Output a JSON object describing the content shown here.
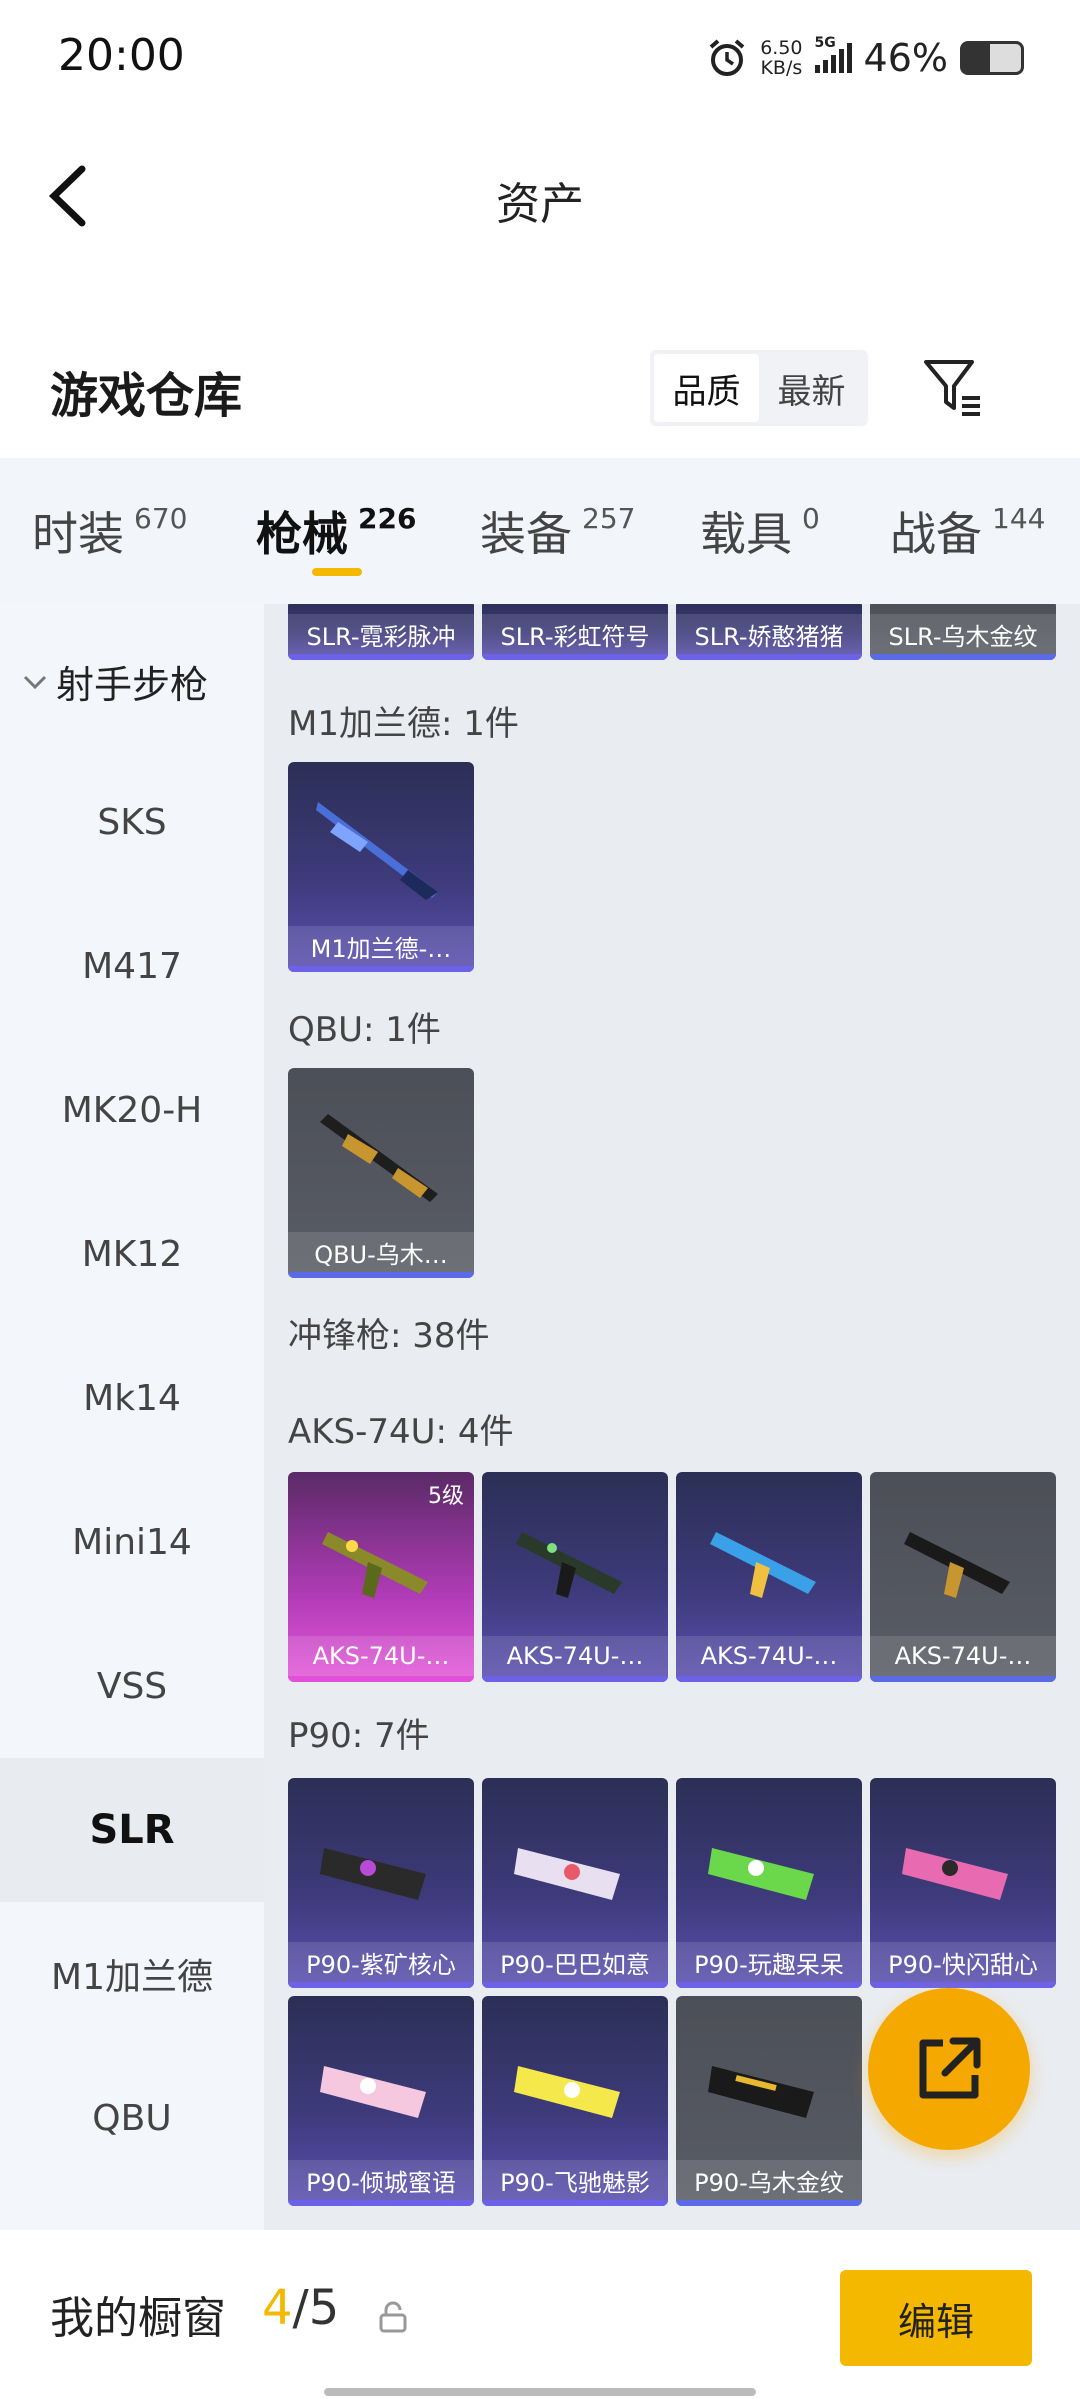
{
  "status_bar": {
    "time": "20:00",
    "net_speed_value": "6.50",
    "net_speed_unit": "KB/s",
    "network": "5G",
    "battery_percent": "46%",
    "battery_level": 0.46,
    "icons": [
      "alarm-icon",
      "signal-icon",
      "battery-icon"
    ]
  },
  "nav": {
    "title": "资产",
    "back_icon": "chevron-left-icon"
  },
  "warehouse": {
    "title": "游戏仓库",
    "sort_options": [
      "品质",
      "最新"
    ],
    "selected_sort": "品质",
    "filter_icon": "filter-icon"
  },
  "tabs": [
    {
      "label": "时装",
      "count": "670"
    },
    {
      "label": "枪械",
      "count": "226",
      "active": true
    },
    {
      "label": "装备",
      "count": "257"
    },
    {
      "label": "载具",
      "count": "0"
    },
    {
      "label": "战备",
      "count": "144"
    }
  ],
  "sidebar": {
    "group": "射手步枪",
    "items": [
      "SKS",
      "M417",
      "MK20-H",
      "MK12",
      "Mk14",
      "Mini14",
      "VSS",
      "SLR",
      "M1加兰德",
      "QBU"
    ],
    "selected": "SLR"
  },
  "content": {
    "top_cards": [
      {
        "name": "SLR-霓彩脉冲",
        "quality": "purple"
      },
      {
        "name": "SLR-彩虹符号",
        "quality": "purple"
      },
      {
        "name": "SLR-娇憨猪猪",
        "quality": "purple"
      },
      {
        "name": "SLR-乌木金纹",
        "quality": "grey"
      }
    ],
    "m1_label": "M1加兰德: 1件",
    "m1_cards": [
      {
        "name": "M1加兰德-…",
        "quality": "purple"
      }
    ],
    "qbu_label": "QBU: 1件",
    "qbu_cards": [
      {
        "name": "QBU-乌木…",
        "quality": "grey"
      }
    ],
    "smg_label": "冲锋枪: 38件",
    "aks_label": "AKS-74U: 4件",
    "aks_cards": [
      {
        "name": "AKS-74U-…",
        "quality": "pink",
        "level": "5级"
      },
      {
        "name": "AKS-74U-…",
        "quality": "purple"
      },
      {
        "name": "AKS-74U-…",
        "quality": "purple"
      },
      {
        "name": "AKS-74U-…",
        "quality": "grey"
      }
    ],
    "p90_label": "P90: 7件",
    "p90_cards": [
      {
        "name": "P90-紫矿核心",
        "quality": "purple"
      },
      {
        "name": "P90-巴巴如意",
        "quality": "purple"
      },
      {
        "name": "P90-玩趣呆呆",
        "quality": "purple"
      },
      {
        "name": "P90-快闪甜心",
        "quality": "purple"
      },
      {
        "name": "P90-倾城蜜语",
        "quality": "purple"
      },
      {
        "name": "P90-飞驰魅影",
        "quality": "purple"
      },
      {
        "name": "P90-乌木金纹",
        "quality": "grey"
      }
    ]
  },
  "fab": {
    "icon": "share-external-icon"
  },
  "bottom": {
    "showcase_label": "我的橱窗",
    "current": "4",
    "separator": "/",
    "max": "5",
    "lock_icon": "lock-icon",
    "edit_label": "编辑"
  }
}
